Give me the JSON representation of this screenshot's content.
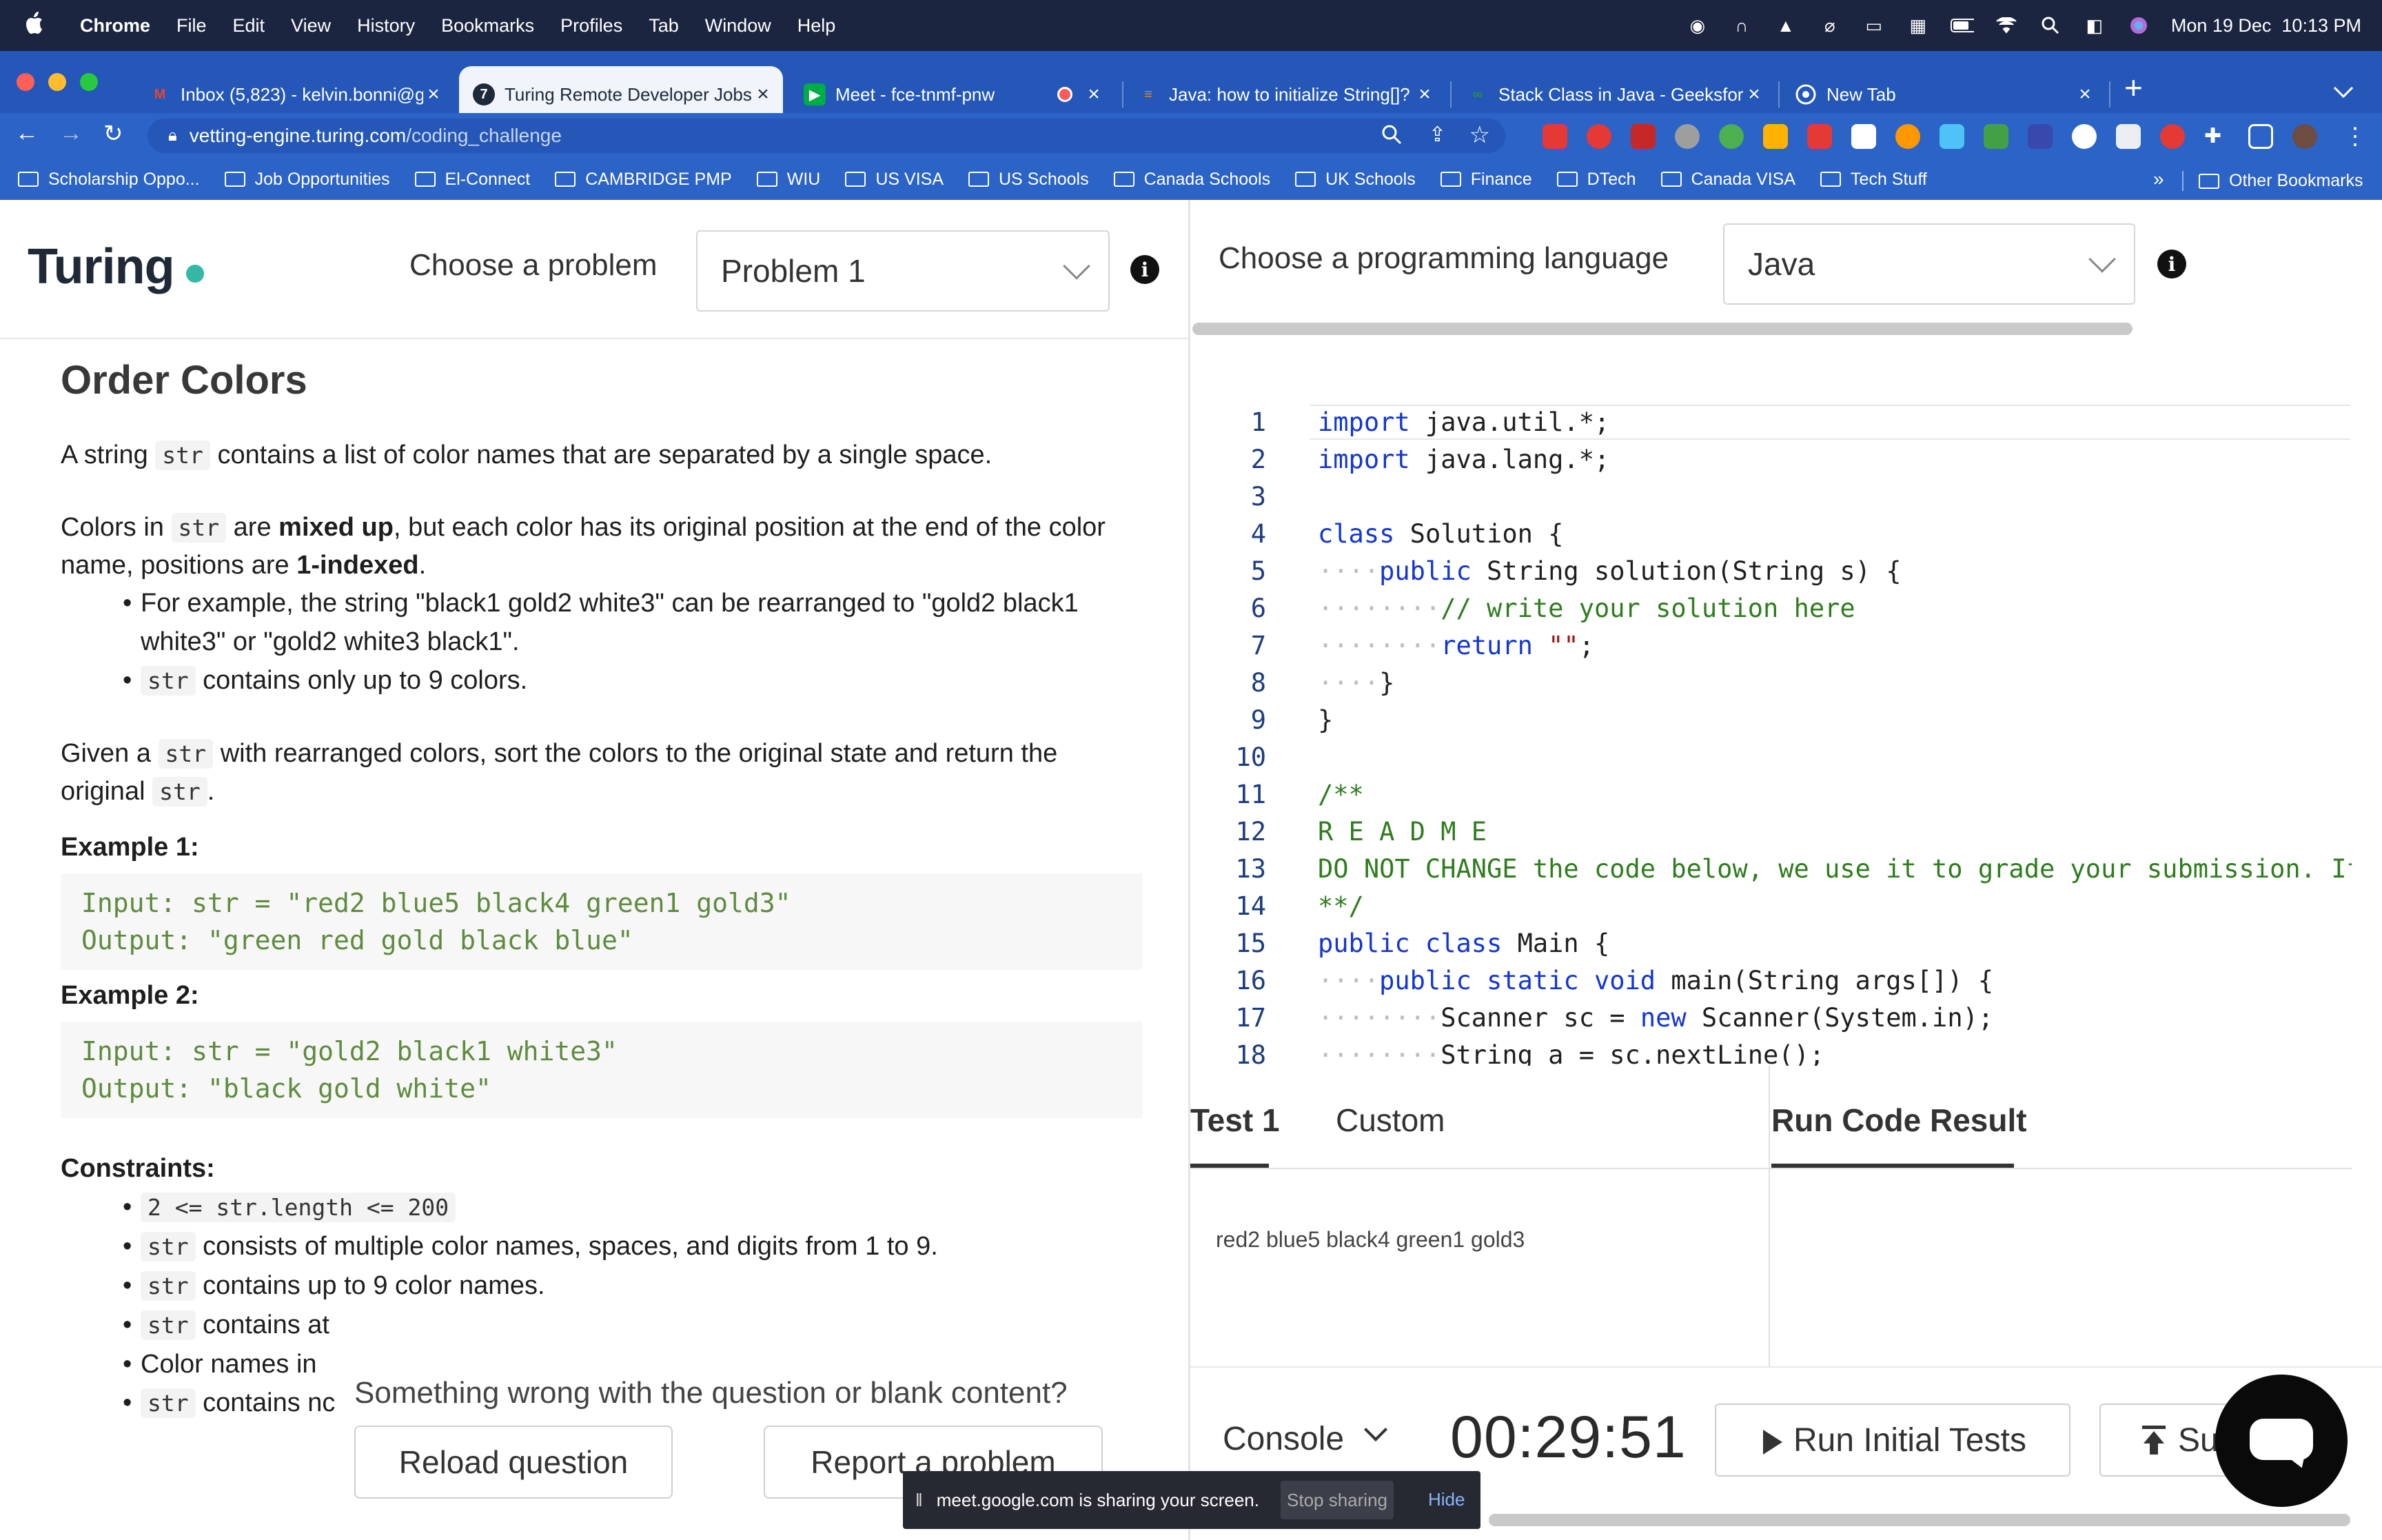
{
  "menubar": {
    "app": "Chrome",
    "items": [
      "File",
      "Edit",
      "View",
      "History",
      "Bookmarks",
      "Profiles",
      "Tab",
      "Window",
      "Help"
    ],
    "datetime": "Mon 19 Dec  10:13 PM"
  },
  "tabs": [
    {
      "title": "Inbox (5,823) - kelvin.bonni@g",
      "icon": "gmail-icon"
    },
    {
      "title": "Turing Remote Developer Jobs",
      "icon": "turing-icon"
    },
    {
      "title": "Meet - fce-tnmf-pnw",
      "icon": "meet-icon"
    },
    {
      "title": "Java: how to initialize String[]?",
      "icon": "stackoverflow-icon"
    },
    {
      "title": "Stack Class in Java - GeeksforG",
      "icon": "geeksforgeeks-icon"
    },
    {
      "title": "New Tab",
      "icon": "chrome-icon"
    }
  ],
  "address": {
    "host": "vetting-engine.turing.com",
    "path": "/coding_challenge"
  },
  "bookmarks": [
    "Scholarship Oppo...",
    "Job Opportunities",
    "El-Connect",
    "CAMBRIDGE PMP",
    "WIU",
    "US VISA",
    "US Schools",
    "Canada Schools",
    "UK Schools",
    "Finance",
    "DTech",
    "Canada VISA",
    "Tech Stuff"
  ],
  "bookmarks_more": "»",
  "bookmarks_other": "Other Bookmarks",
  "header": {
    "logo": "Turing",
    "choose_problem_label": "Choose a problem",
    "problem_value": "Problem 1",
    "choose_language_label": "Choose a programming language",
    "language_value": "Java"
  },
  "problem": {
    "title": "Order Colors",
    "p1_pre": "A string ",
    "p1_code": "str",
    "p1_post": " contains a list of color names that are separated by a single space.",
    "p2_pre": "Colors in ",
    "p2_code": "str",
    "p2_mid1": " are ",
    "p2_bold1": "mixed up",
    "p2_mid2": ", but each color has its original position at the end of the color name, positions are ",
    "p2_bold2": "1-indexed",
    "p2_end": ".",
    "b1": "For example, the string \"black1 gold2 white3\" can be rearranged to \"gold2 black1 white3\" or \"gold2 white3 black1\".",
    "b2_code": "str",
    "b2_text": " contains only up to 9 colors.",
    "p3_pre": "Given a ",
    "p3_code": "str",
    "p3_mid": " with rearranged colors, sort the colors to the original state and return the original ",
    "p3_code2": "str",
    "p3_end": ".",
    "ex1_label": "Example 1:",
    "ex1_input": "Input: str = \"red2 blue5 black4 green1 gold3\"",
    "ex1_output": "Output: \"green red gold black blue\"",
    "ex2_label": "Example 2:",
    "ex2_input": "Input: str = \"gold2 black1 white3\"",
    "ex2_output": "Output: \"black gold white\"",
    "constraints_label": "Constraints:",
    "c1_code": "2 <= str.length <= 200",
    "c2_code": "str",
    "c2_text": " consists of multiple color names, spaces, and digits from 1 to 9.",
    "c3_code": "str",
    "c3_text": " contains up to 9 color names.",
    "c4_code": "str",
    "c4_text": " contains at",
    "c5_text": "Color names in",
    "c6_code": "str",
    "c6_text": " contains nc"
  },
  "report": {
    "question": "Something wrong with the question or blank content?",
    "reload": "Reload question",
    "report": "Report a problem"
  },
  "editor": {
    "lines": [
      {
        "n": "1"
      },
      {
        "n": "2"
      },
      {
        "n": "3"
      },
      {
        "n": "4"
      },
      {
        "n": "5"
      },
      {
        "n": "6"
      },
      {
        "n": "7"
      },
      {
        "n": "8"
      },
      {
        "n": "9"
      },
      {
        "n": "10"
      },
      {
        "n": "11"
      },
      {
        "n": "12"
      },
      {
        "n": "13"
      },
      {
        "n": "14"
      },
      {
        "n": "15"
      },
      {
        "n": "16"
      },
      {
        "n": "17"
      },
      {
        "n": "18"
      }
    ],
    "code": {
      "l1a": "import",
      "l1b": " java.util.*;",
      "l2a": "import",
      "l2b": " java.lang.*;",
      "l4a": "class",
      "l4b": " Solution {",
      "l5a": "public",
      "l5b": " String solution(String s) {",
      "l6": "// write your solution here",
      "l7a": "return",
      "l7b": "\"\"",
      "l7c": ";",
      "l8": "}",
      "l9": "}",
      "l11": "/**",
      "l12": "R E A D M E",
      "l13": "DO NOT CHANGE the code below, we use it to grade your submission. If",
      "l14": "**/",
      "l15a": "public class",
      "l15b": " Main {",
      "l16a": "public static void",
      "l16b": " main(String args[]) {",
      "l17a": "Scanner sc = ",
      "l17b": "new",
      "l17c": " Scanner(System.in);",
      "l18": "String a = sc.nextLine();"
    }
  },
  "tests": {
    "tab1": "Test 1",
    "tab2": "Custom",
    "tab3": "Run Code Result",
    "input": "red2 blue5 black4 green1 gold3"
  },
  "console": {
    "label": "Console",
    "timer": "00:29:51",
    "run": "Run Initial Tests",
    "submit": "Su"
  },
  "share": {
    "message": "meet.google.com is sharing your screen.",
    "stop": "Stop sharing",
    "hide": "Hide"
  }
}
